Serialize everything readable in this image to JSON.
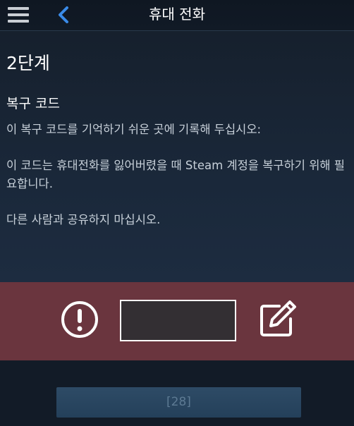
{
  "header": {
    "title": "휴대 전화",
    "menu_icon": "hamburger-menu-icon",
    "back_icon": "chevron-left-icon",
    "accent_color": "#3a8be8"
  },
  "content": {
    "step_title": "2단계",
    "section_title": "복구 코드",
    "paragraphs": [
      "이 복구 코드를 기억하기 쉬운 곳에 기록해 두십시오:",
      "이 코드는 휴대전화를 잃어버렸을 때 Steam 계정을 복구하기 위해 필요합니다.",
      "다른 사람과 공유하지 마십시오."
    ]
  },
  "code_panel": {
    "alert_icon": "exclamation-circle-icon",
    "code_value": "",
    "edit_icon": "edit-pencil-icon",
    "band_color": "#6a353e"
  },
  "footer": {
    "continue_label": "[28]"
  }
}
